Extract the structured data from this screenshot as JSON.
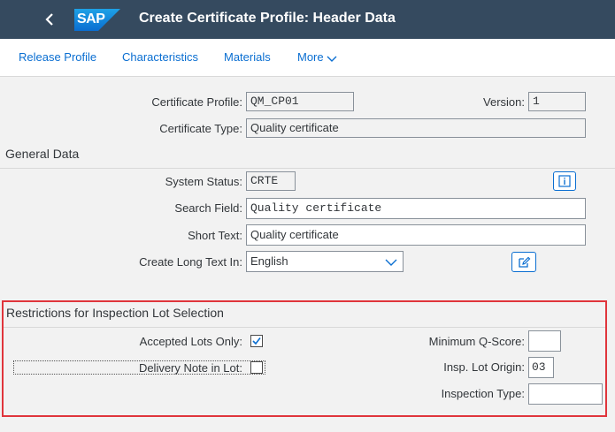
{
  "header": {
    "logo_text": "SAP",
    "title": "Create Certificate Profile: Header Data"
  },
  "toolbar": {
    "items": [
      "Release Profile",
      "Characteristics",
      "Materials",
      "More"
    ]
  },
  "profile": {
    "certificate_profile_label": "Certificate Profile:",
    "certificate_profile_value": "QM_CP01",
    "version_label": "Version:",
    "version_value": "1",
    "certificate_type_label": "Certificate Type:",
    "certificate_type_value": "Quality certificate"
  },
  "general": {
    "title": "General Data",
    "system_status_label": "System Status:",
    "system_status_value": "CRTE",
    "search_field_label": "Search Field:",
    "search_field_value": "Quality certificate",
    "short_text_label": "Short Text:",
    "short_text_value": "Quality certificate",
    "long_text_label": "Create Long Text In:",
    "long_text_value": "English"
  },
  "restrictions": {
    "title": "Restrictions for Inspection Lot Selection",
    "accepted_lots_label": "Accepted Lots Only:",
    "accepted_lots_checked": true,
    "delivery_note_label": "Delivery Note in Lot:",
    "delivery_note_checked": false,
    "min_qscore_label": "Minimum Q-Score:",
    "min_qscore_value": "",
    "insp_lot_origin_label": "Insp. Lot Origin:",
    "insp_lot_origin_value": "03",
    "inspection_type_label": "Inspection Type:",
    "inspection_type_value": ""
  },
  "colors": {
    "shell": "#354a5f",
    "link": "#0a6ed1",
    "highlight": "#e0353c"
  },
  "icons": {
    "back": "chevron-left-icon",
    "info": "info-icon",
    "edit": "edit-icon",
    "dropdown": "chevron-down-icon",
    "checkmark": "checkmark-icon"
  }
}
